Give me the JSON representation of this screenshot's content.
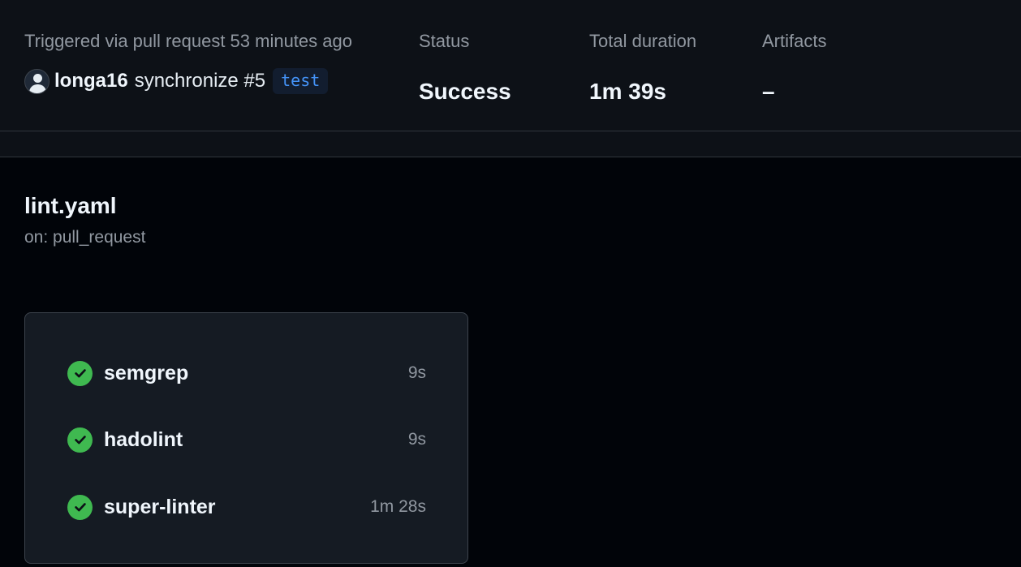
{
  "summary": {
    "triggered_label": "Triggered via pull request 53 minutes ago",
    "actor": "longa16",
    "event": "synchronize #5",
    "branch": "test",
    "status_label": "Status",
    "status_value": "Success",
    "duration_label": "Total duration",
    "duration_value": "1m 39s",
    "artifacts_label": "Artifacts",
    "artifacts_value": "–"
  },
  "workflow": {
    "file": "lint.yaml",
    "trigger": "on: pull_request"
  },
  "jobs": [
    {
      "name": "semgrep",
      "duration": "9s",
      "status": "success",
      "icon": "check-circle-icon"
    },
    {
      "name": "hadolint",
      "duration": "9s",
      "status": "success",
      "icon": "check-circle-icon"
    },
    {
      "name": "super-linter",
      "duration": "1m 28s",
      "status": "success",
      "icon": "check-circle-icon"
    }
  ],
  "colors": {
    "success": "#3fb950",
    "branch_text": "#4493f8",
    "background": "#010409",
    "panel": "#0d1117"
  }
}
